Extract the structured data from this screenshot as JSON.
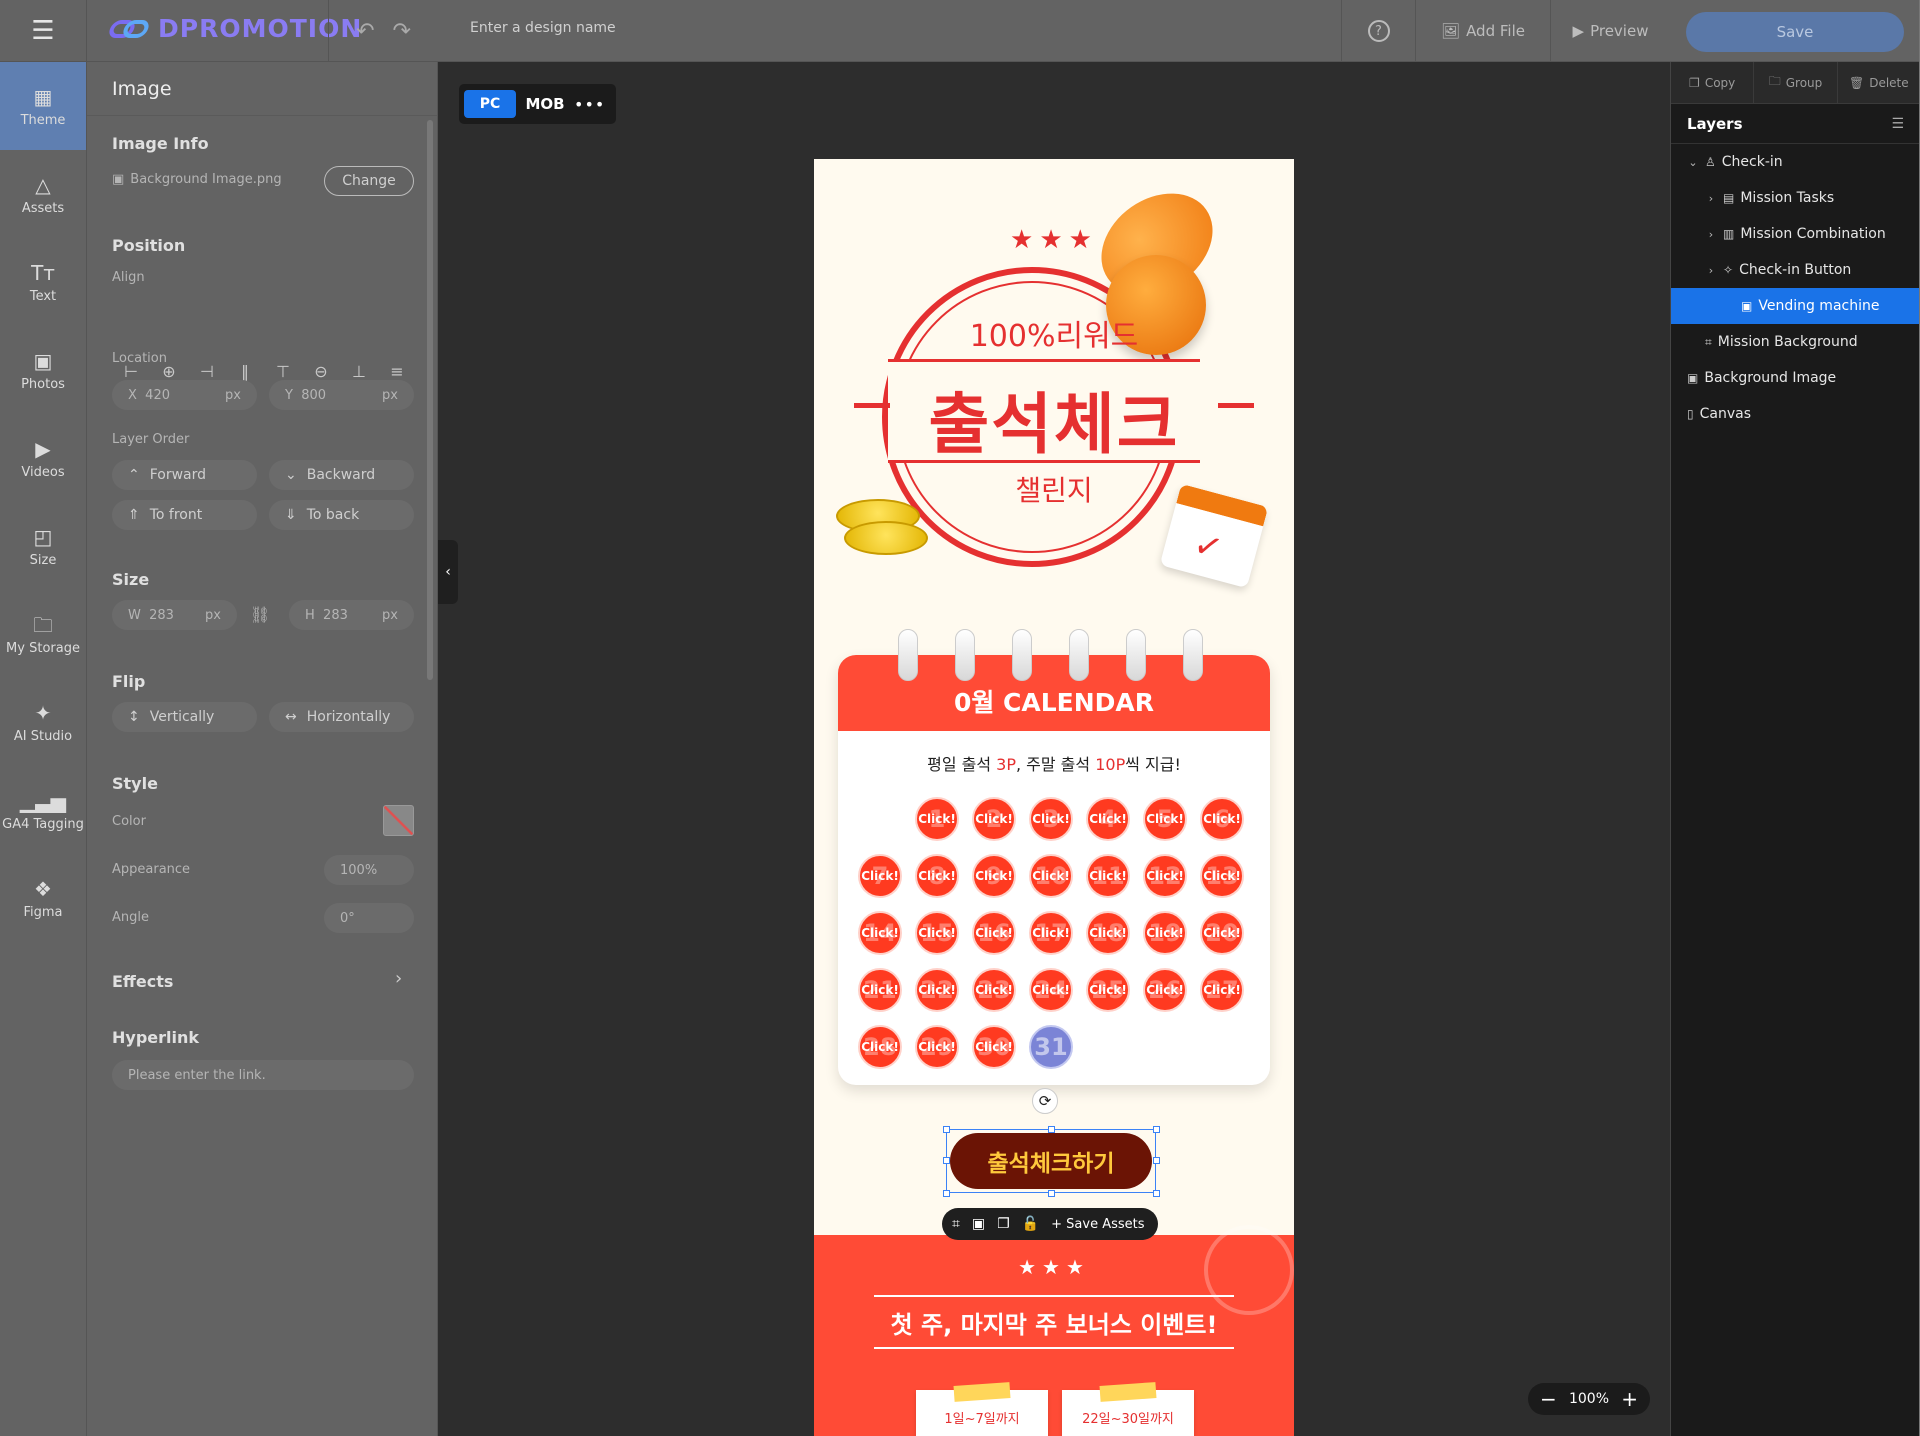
{
  "topbar": {
    "logo_text": "DPROMOTION",
    "design_name_placeholder": "Enter a design name",
    "add_file_label": "Add File",
    "preview_label": "Preview",
    "save_label": "Save"
  },
  "iconbar": {
    "items": [
      {
        "label": "Theme",
        "icon": "theme-icon"
      },
      {
        "label": "Assets",
        "icon": "assets-icon"
      },
      {
        "label": "Text",
        "icon": "text-icon"
      },
      {
        "label": "Photos",
        "icon": "photos-icon"
      },
      {
        "label": "Videos",
        "icon": "videos-icon"
      },
      {
        "label": "Size",
        "icon": "size-icon"
      },
      {
        "label": "My Storage",
        "icon": "folder-icon"
      },
      {
        "label": "AI Studio",
        "icon": "magic-wand-icon"
      },
      {
        "label": "GA4 Tagging",
        "icon": "bar-chart-icon"
      },
      {
        "label": "Figma",
        "icon": "figma-icon"
      }
    ]
  },
  "props": {
    "title": "Image",
    "image_info": {
      "heading": "Image Info",
      "file_name": "Background Image.png",
      "change_label": "Change"
    },
    "position": {
      "heading": "Position",
      "align_label": "Align",
      "location_label": "Location",
      "x_label": "X",
      "x_value": "420",
      "y_label": "Y",
      "y_value": "800",
      "unit": "px",
      "layer_order_label": "Layer Order",
      "forward": "Forward",
      "backward": "Backward",
      "to_front": "To front",
      "to_back": "To back"
    },
    "size": {
      "heading": "Size",
      "w_label": "W",
      "w_value": "283",
      "h_label": "H",
      "h_value": "283",
      "unit": "px"
    },
    "flip": {
      "heading": "Flip",
      "vertically": "Vertically",
      "horizontally": "Horizontally"
    },
    "style": {
      "heading": "Style",
      "color_label": "Color",
      "appearance_label": "Appearance",
      "appearance_value": "100%",
      "angle_label": "Angle",
      "angle_value": "0°"
    },
    "effects_heading": "Effects",
    "hyperlink": {
      "heading": "Hyperlink",
      "placeholder": "Please enter the link."
    }
  },
  "workspace": {
    "device_pc": "PC",
    "device_mob": "MOB",
    "zoom_value": "100%"
  },
  "canvas": {
    "stars": "★★★",
    "reward_text": "100%리워드",
    "title": "출석체크",
    "challenge": "챌린지",
    "calendar_title": "0월 CALENDAR",
    "subtitle_parts": [
      "평일 출석 ",
      "3P",
      ", 주말 출석 ",
      "10P",
      "씩 지급!"
    ],
    "click_label": "Click!",
    "days": [
      "1",
      "2",
      "3",
      "4",
      "5",
      "6",
      "7",
      "8",
      "9",
      "10",
      "11",
      "12",
      "13",
      "14",
      "15",
      "16",
      "17",
      "18",
      "19",
      "20",
      "21",
      "22",
      "23",
      "24",
      "25",
      "26",
      "27",
      "28",
      "29",
      "30",
      "31"
    ],
    "checkin_button": "출석체크하기",
    "save_assets": "Save Assets",
    "bonus_title": "첫 주, 마지막 주 보너스 이벤트!",
    "bonus_note_1": "1일~7일까지",
    "bonus_note_2": "22일~30일까지"
  },
  "right_panel": {
    "copy": "Copy",
    "group": "Group",
    "delete": "Delete",
    "layers_title": "Layers",
    "layers": [
      {
        "label": "Check-in",
        "level": 0,
        "expanded": true
      },
      {
        "label": "Mission Tasks",
        "level": 1,
        "expanded": false
      },
      {
        "label": "Mission Combination",
        "level": 1,
        "expanded": false
      },
      {
        "label": "Check-in Button",
        "level": 1,
        "expanded": false
      },
      {
        "label": "Vending machine",
        "level": 2,
        "selected": true
      },
      {
        "label": "Mission Background",
        "level": 1
      },
      {
        "label": "Background Image",
        "level": 0
      },
      {
        "label": "Canvas",
        "level": 0
      }
    ]
  },
  "colors": {
    "accent": "#1a73e8",
    "brand_red": "#e53030",
    "calendar_red": "#ff4b36",
    "button_brown": "#6b1405",
    "button_text": "#ffc93c"
  }
}
